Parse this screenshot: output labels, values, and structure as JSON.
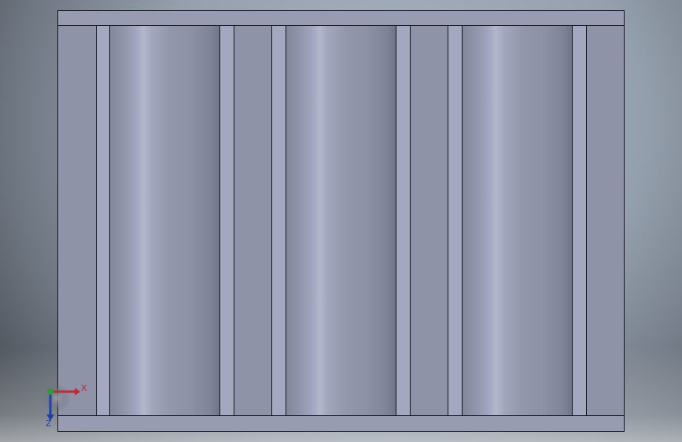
{
  "colors": {
    "edge": "#15161a",
    "face": "#8e93a8",
    "strip": "#a3a7bf",
    "x_axis": "#c8262d",
    "y_axis": "#2f9c3a",
    "z_axis": "#1f3fae"
  },
  "triad": {
    "x_label": "X",
    "z_label": "Z"
  },
  "icons": {
    "triad": "xyz-coordinate-triad-icon"
  }
}
